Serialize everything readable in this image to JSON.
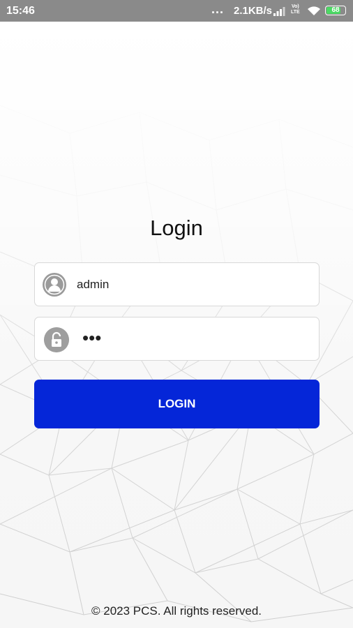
{
  "status_bar": {
    "time": "15:46",
    "dots": "...",
    "network_speed": "2.1KB/s",
    "lte_top": "Vo)",
    "lte_bottom": "LTE",
    "battery": "68",
    "battery_color": "#4cd964"
  },
  "login": {
    "title": "Login",
    "username_value": "admin",
    "password_value": "•••",
    "button_label": "LOGIN",
    "button_color": "#0526d8"
  },
  "footer": {
    "copyright": "© 2023 PCS. All rights reserved."
  },
  "icons": {
    "username": "user-icon",
    "password": "lock-icon"
  }
}
